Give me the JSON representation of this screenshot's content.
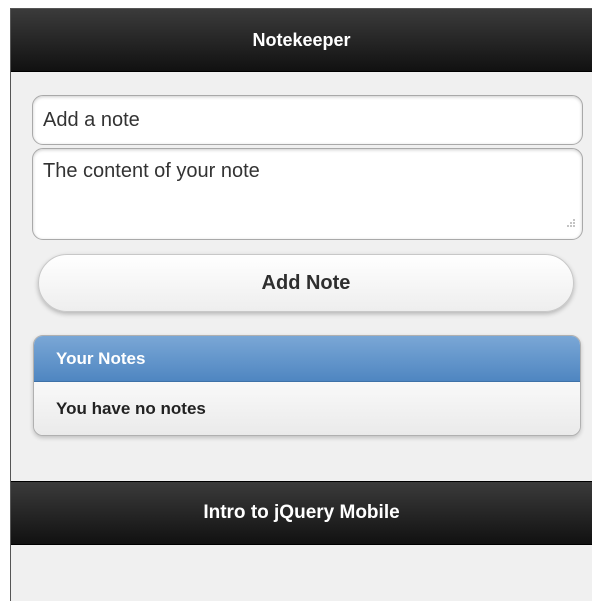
{
  "header": {
    "title": "Notekeeper"
  },
  "form": {
    "title_placeholder": "Add a note",
    "content_placeholder": "The content of your note",
    "add_button_label": "Add Note"
  },
  "notes": {
    "header": "Your Notes",
    "empty_message": "You have no notes"
  },
  "footer": {
    "title": "Intro to jQuery Mobile"
  },
  "colors": {
    "bar_dark": "#1c1c1c",
    "list_header_blue": "#5a8fc7",
    "page_background": "#f0f0f0"
  }
}
